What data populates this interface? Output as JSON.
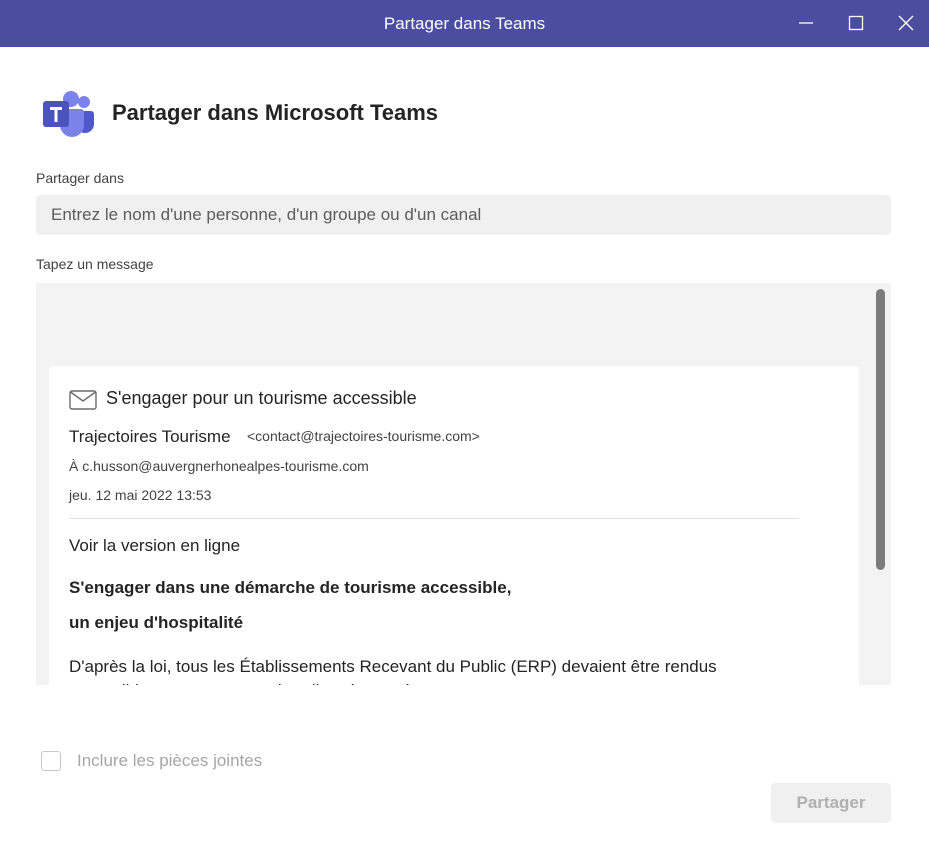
{
  "window": {
    "title": "Partager dans Teams",
    "titlebar_color": "#4b4d9e"
  },
  "header": {
    "title": "Partager dans Microsoft Teams",
    "logo_icon": "microsoft-teams-logo"
  },
  "share_to": {
    "label": "Partager dans",
    "placeholder": "Entrez le nom d'une personne, d'un groupe ou d'un canal",
    "value": ""
  },
  "message": {
    "label": "Tapez un message",
    "email_card": {
      "subject": "S'engager pour un tourisme accessible",
      "sender_name": "Trajectoires Tourisme",
      "sender_email": "<contact@trajectoires-tourisme.com>",
      "recipient": "À c.husson@auvergnerhonealpes-tourisme.com",
      "date": "jeu. 12 mai 2022 13:53",
      "online_link": "Voir la version en ligne",
      "heading_line1": "S'engager dans une démarche de tourisme accessible,",
      "heading_line2": "un enjeu d'hospitalité",
      "body": "D'après la loi, tous les Établissements Recevant du Public (ERP) devaient être rendus accessibles aux personnes handicapées après"
    }
  },
  "attachments": {
    "label": "Inclure les pièces jointes",
    "checked": false
  },
  "actions": {
    "share_label": "Partager",
    "share_enabled": false
  }
}
